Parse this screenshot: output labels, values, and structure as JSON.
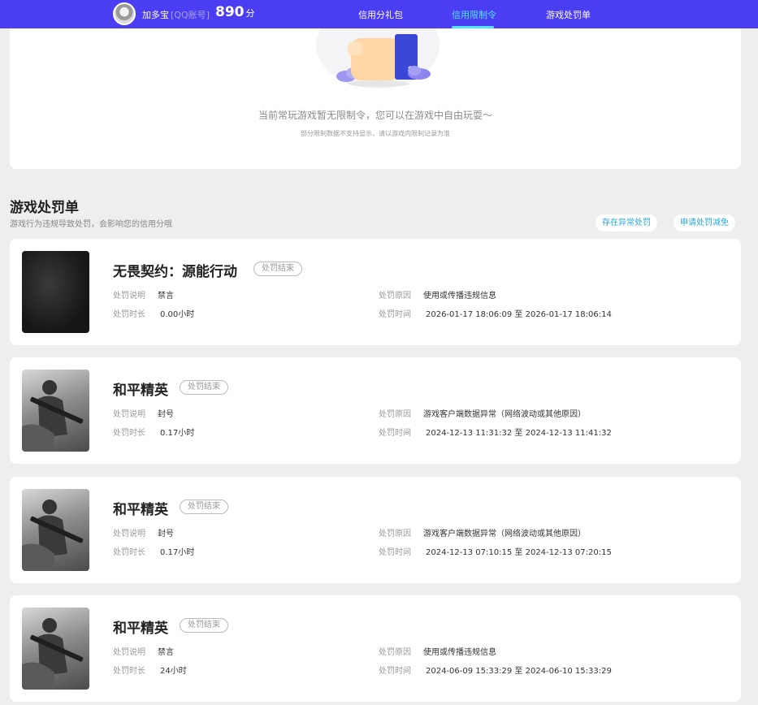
{
  "header": {
    "username": "加多宝",
    "account_tag": "[QQ账号]",
    "score": "890",
    "score_unit": "分",
    "tabs": [
      {
        "label": "信用分礼包",
        "active": false
      },
      {
        "label": "信用限制令",
        "active": true
      },
      {
        "label": "游戏处罚单",
        "active": false
      }
    ],
    "colors": {
      "bar": "#4b3df2",
      "active_tab": "#4fe3ff"
    }
  },
  "restriction": {
    "message": "当前常玩游戏暂无限制令，您可以在游戏中自由玩耍～",
    "note": "部分限制数据不支持显示，请以游戏内限制记录为准"
  },
  "penalties_section": {
    "title": "游戏处罚单",
    "description": "游戏行为违规导致处罚，会影响您的信用分哦",
    "actions": [
      "存在异常处罚",
      "申请处罚减免"
    ]
  },
  "labels": {
    "desc": "处罚说明",
    "duration": "处罚时长",
    "reason": "处罚原因",
    "time": "处罚时间",
    "to": "至"
  },
  "penalties": [
    {
      "game": "无畏契约：源能行动",
      "status": "处罚结束",
      "type": "禁言",
      "duration": "0.00小时",
      "reason": "使用或传播违规信息",
      "start": "2026-01-17 18:06:09",
      "end": "2026-01-17 18:06:14",
      "thumb": "dark"
    },
    {
      "game": "和平精英",
      "status": "处罚结束",
      "type": "封号",
      "duration": "0.17小时",
      "reason": "游戏客户端数据异常（网络波动或其他原因）",
      "start": "2024-12-13 11:31:32",
      "end": "2024-12-13 11:41:32",
      "thumb": "pubg"
    },
    {
      "game": "和平精英",
      "status": "处罚结束",
      "type": "封号",
      "duration": "0.17小时",
      "reason": "游戏客户端数据异常（网络波动或其他原因）",
      "start": "2024-12-13 07:10:15",
      "end": "2024-12-13 07:20:15",
      "thumb": "pubg"
    },
    {
      "game": "和平精英",
      "status": "处罚结束",
      "type": "禁言",
      "duration": "24小时",
      "reason": "使用或传播违规信息",
      "start": "2024-06-09 15:33:29",
      "end": "2024-06-10 15:33:29",
      "thumb": "pubg"
    }
  ]
}
